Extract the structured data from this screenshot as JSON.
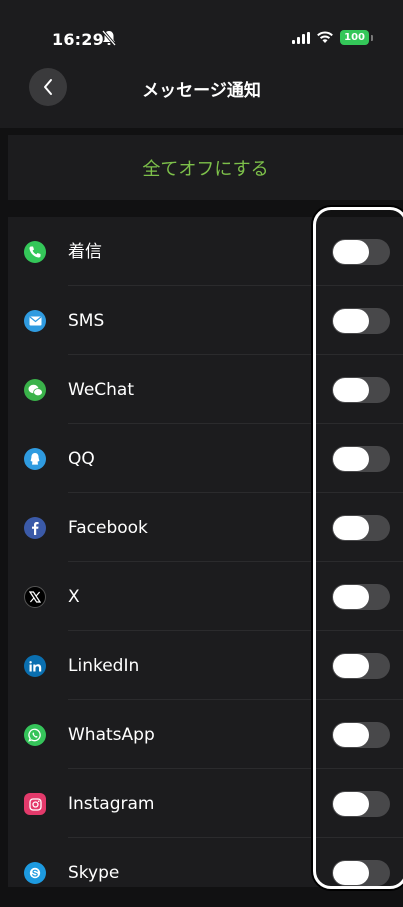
{
  "status_bar": {
    "time": "16:29",
    "battery": "100"
  },
  "nav": {
    "title": "メッセージ通知"
  },
  "all_off_button": "全てオフにする",
  "apps": [
    {
      "name": "着信",
      "icon": "phone-icon",
      "color": "#34c759",
      "enabled": false
    },
    {
      "name": "SMS",
      "icon": "sms-icon",
      "color": "#2f9be0",
      "enabled": false
    },
    {
      "name": "WeChat",
      "icon": "wechat-icon",
      "color": "#3ab24a",
      "enabled": false
    },
    {
      "name": "QQ",
      "icon": "qq-icon",
      "color": "#2f9be0",
      "enabled": false
    },
    {
      "name": "Facebook",
      "icon": "facebook-icon",
      "color": "#3b5aa8",
      "enabled": false
    },
    {
      "name": "X",
      "icon": "x-icon",
      "color": "#000000",
      "enabled": false
    },
    {
      "name": "LinkedIn",
      "icon": "linkedin-icon",
      "color": "#0a6fb0",
      "enabled": false
    },
    {
      "name": "WhatsApp",
      "icon": "whatsapp-icon",
      "color": "#35c45a",
      "enabled": false
    },
    {
      "name": "Instagram",
      "icon": "instagram-icon",
      "color": "#e33a6b",
      "enabled": false
    },
    {
      "name": "Skype",
      "icon": "skype-icon",
      "color": "#1d9ae0",
      "enabled": false
    }
  ]
}
